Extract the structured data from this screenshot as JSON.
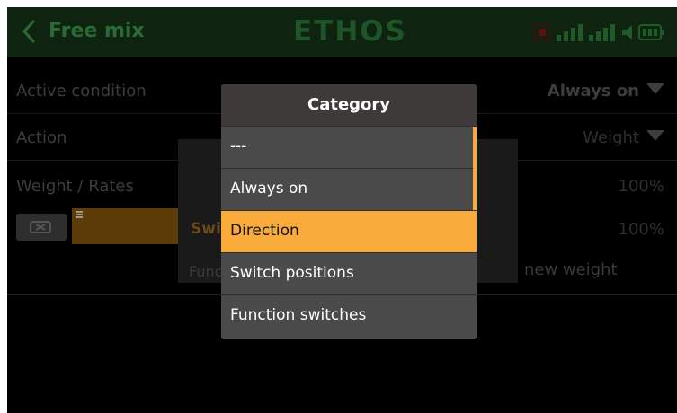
{
  "header": {
    "title": "Free mix",
    "logo": "ETHOS"
  },
  "rows": {
    "active_condition": {
      "label": "Active condition",
      "value": "Always on"
    },
    "action": {
      "label": "Action",
      "value": "Weight"
    },
    "weight": {
      "label": "Weight / Rates",
      "value": "100%"
    },
    "curve_value": "100%"
  },
  "background_dialog": {
    "title_fragment": "Swi",
    "text_fragment": "Func",
    "suffix_fragment": "new weight"
  },
  "popup": {
    "title": "Category",
    "options": [
      "---",
      "Always on",
      "Direction",
      "Switch positions",
      "Function switches"
    ],
    "selected_index": 2
  },
  "colors": {
    "accent": "#f8ab3a",
    "header_bg": "#0e2410",
    "title_text": "#2a6a36",
    "popup_bg": "#4a4a4a"
  }
}
